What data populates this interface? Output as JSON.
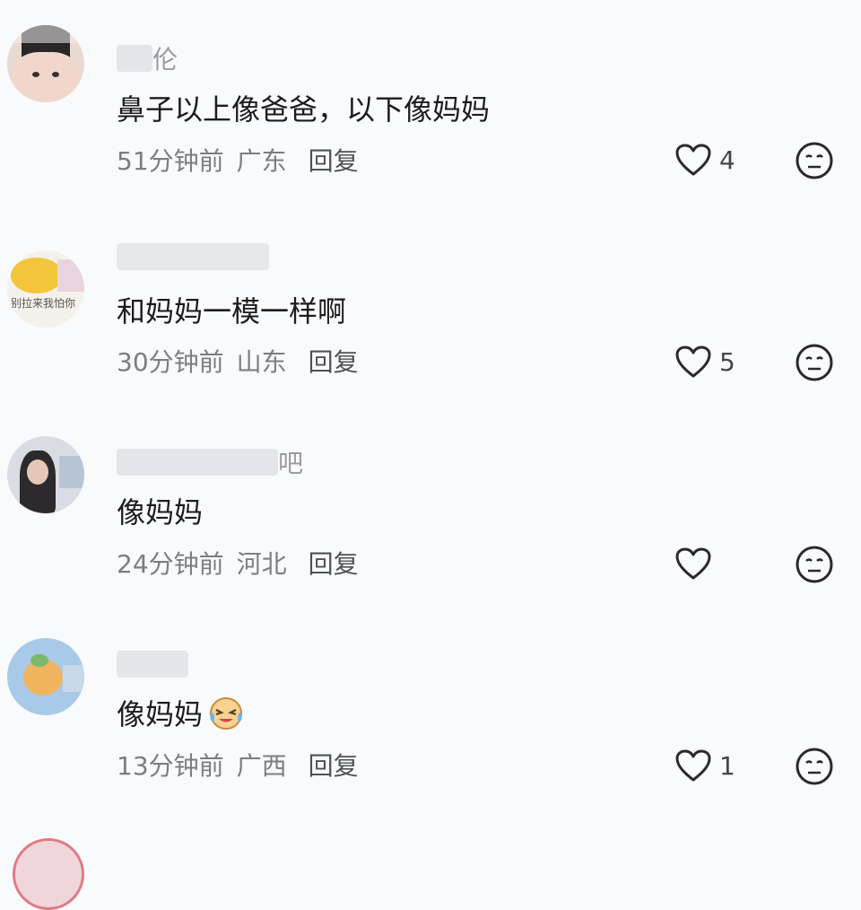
{
  "comments": [
    {
      "username_tail": "伦",
      "text": "鼻子以上像爸爸，以下像妈妈",
      "time": "51分钟前",
      "location": "广东",
      "reply": "回复",
      "likes": "4",
      "emoji": ""
    },
    {
      "username_tail": "",
      "text": "和妈妈一模一样啊",
      "time": "30分钟前",
      "location": "山东",
      "reply": "回复",
      "likes": "5",
      "emoji": ""
    },
    {
      "username_tail": "吧",
      "text": "像妈妈",
      "time": "24分钟前",
      "location": "河北",
      "reply": "回复",
      "likes": "",
      "emoji": ""
    },
    {
      "username_tail": "",
      "text": "像妈妈",
      "time": "13分钟前",
      "location": "广西",
      "reply": "回复",
      "likes": "1",
      "emoji": "crying-laughing-emoji"
    }
  ],
  "avatars": [
    {
      "style": "child-photo"
    },
    {
      "style": "sun-badge",
      "caption": "别拉来我怕你"
    },
    {
      "style": "girl-photo"
    },
    {
      "style": "peach-cartoon"
    }
  ],
  "icons": {
    "like": "heart-outline-icon",
    "dislike": "neutral-face-icon"
  },
  "colors": {
    "background": "#f9fafc",
    "text": "#1c1c1e",
    "meta": "#7c7d83",
    "icon": "#2a2a2e"
  }
}
